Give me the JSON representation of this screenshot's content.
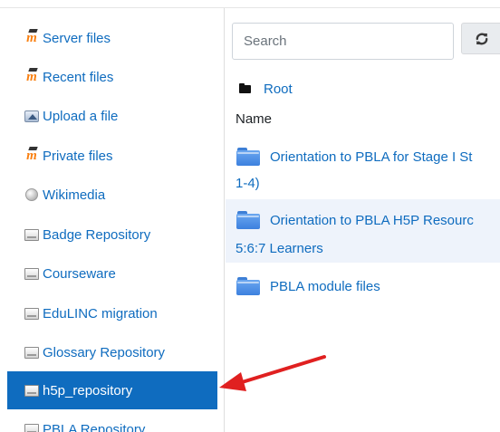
{
  "sidebar": {
    "items": [
      {
        "label": "Server files",
        "icon": "moodle-icon"
      },
      {
        "label": "Recent files",
        "icon": "moodle-icon"
      },
      {
        "label": "Upload a file",
        "icon": "upload-icon"
      },
      {
        "label": "Private files",
        "icon": "moodle-icon"
      },
      {
        "label": "Wikimedia",
        "icon": "globe-icon"
      },
      {
        "label": "Badge Repository",
        "icon": "repository-icon"
      },
      {
        "label": "Courseware",
        "icon": "repository-icon"
      },
      {
        "label": "EduLINC migration",
        "icon": "repository-icon"
      },
      {
        "label": "Glossary Repository",
        "icon": "repository-icon"
      },
      {
        "label": "h5p_repository",
        "icon": "repository-icon",
        "selected": true
      },
      {
        "label": "PBLA Repository",
        "icon": "repository-icon"
      }
    ]
  },
  "main": {
    "search": {
      "placeholder": "Search",
      "value": ""
    },
    "refresh_icon": "refresh-icon",
    "breadcrumb": {
      "icon": "folder-icon",
      "label": "Root"
    },
    "column_header": "Name",
    "files": [
      {
        "line1": "Orientation to PBLA for Stage I St",
        "line2": "1-4)",
        "icon": "folder-icon"
      },
      {
        "line1": "Orientation to PBLA H5P Resourc",
        "line2": "5:6:7 Learners",
        "icon": "folder-icon"
      },
      {
        "line1": "PBLA module files",
        "line2": "",
        "icon": "folder-icon"
      }
    ]
  },
  "colors": {
    "accent": "#0f6cbf",
    "selected_bg": "#0f6cbf",
    "alt_row_bg": "#eef3fb",
    "folder": "#4a8ee6",
    "annotation_arrow": "#e02020"
  }
}
